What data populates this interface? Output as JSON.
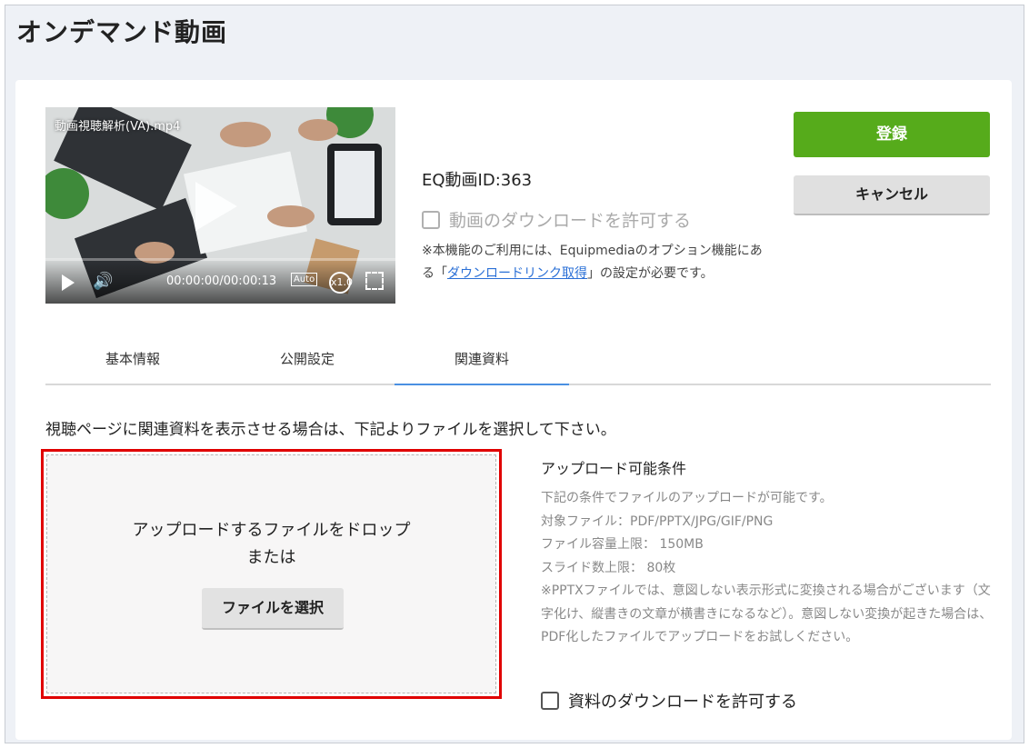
{
  "page": {
    "title": "オンデマンド動画"
  },
  "video": {
    "filename": "動画視聴解析(VA).mp4",
    "time": "00:00:00/00:00:13",
    "quality": "Auto",
    "speed": "x1.0"
  },
  "info": {
    "eq_id": "EQ動画ID:363",
    "download_label": "動画のダウンロードを許可する",
    "note_before": "※本機能のご利用には、Equipmediaのオプション機能にある「",
    "note_link": "ダウンロードリンク取得",
    "note_after": "」の設定が必要です。"
  },
  "buttons": {
    "register": "登録",
    "cancel": "キャンセル"
  },
  "tabs": [
    {
      "label": "基本情報"
    },
    {
      "label": "公開設定"
    },
    {
      "label": "関連資料"
    }
  ],
  "instruction": "視聴ページに関連資料を表示させる場合は、下記よりファイルを選択して下さい。",
  "dropzone": {
    "line1": "アップロードするファイルをドロップ",
    "line2": "または",
    "button": "ファイルを選択"
  },
  "conditions": {
    "title": "アップロード可能条件",
    "lines": [
      "下記の条件でファイルのアップロードが可能です。",
      "対象ファイル：PDF/PPTX/JPG/GIF/PNG",
      "ファイル容量上限： 150MB",
      "スライド数上限： 80枚",
      "※PPTXファイルでは、意図しない表示形式に変換される場合がございます（文字化け、縦書きの文章が横書きになるなど）。意図しない変換が起きた場合は、PDF化したファイルでアップロードをお試しください。"
    ]
  },
  "materials": {
    "download_label": "資料のダウンロードを許可する"
  }
}
